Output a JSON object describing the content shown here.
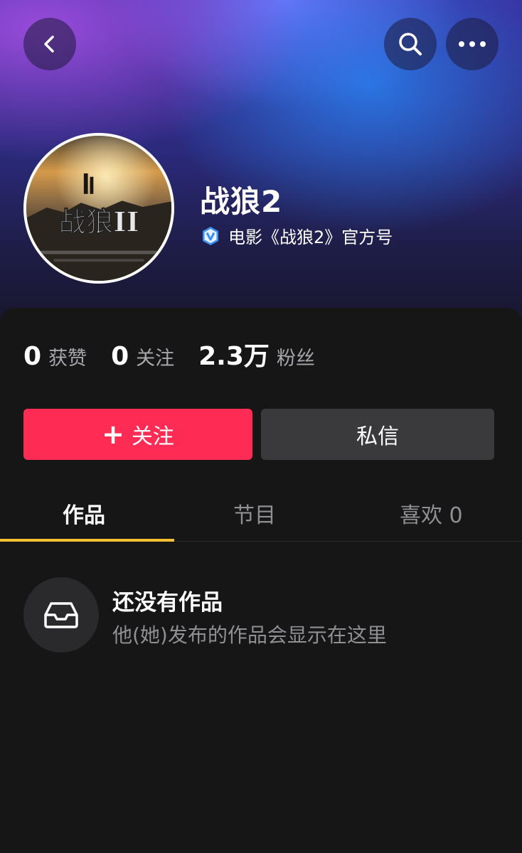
{
  "header": {
    "back_icon": "chevron-left-icon",
    "search_icon": "search-icon",
    "more_icon": "more-dots-icon"
  },
  "profile": {
    "name": "战狼2",
    "verified_badge_icon": "verified-v-icon",
    "verified_text": "电影《战狼2》官方号",
    "avatar_alt": "战狼II"
  },
  "stats": [
    {
      "value": "0",
      "label": "获赞"
    },
    {
      "value": "0",
      "label": "关注"
    },
    {
      "value": "2.3万",
      "label": "粉丝"
    }
  ],
  "actions": {
    "follow_plus": "+",
    "follow_label": "关注",
    "message_label": "私信"
  },
  "tabs": [
    {
      "label": "作品",
      "active": true
    },
    {
      "label": "节目",
      "active": false
    },
    {
      "label": "喜欢 0",
      "active": false
    }
  ],
  "empty_state": {
    "icon": "inbox-tray-icon",
    "title": "还没有作品",
    "description": "他(她)发布的作品会显示在这里"
  },
  "colors": {
    "follow_button": "#fe2c55",
    "message_button": "#3a3a3c",
    "tab_indicator": "#f4c134",
    "background": "#161616"
  }
}
